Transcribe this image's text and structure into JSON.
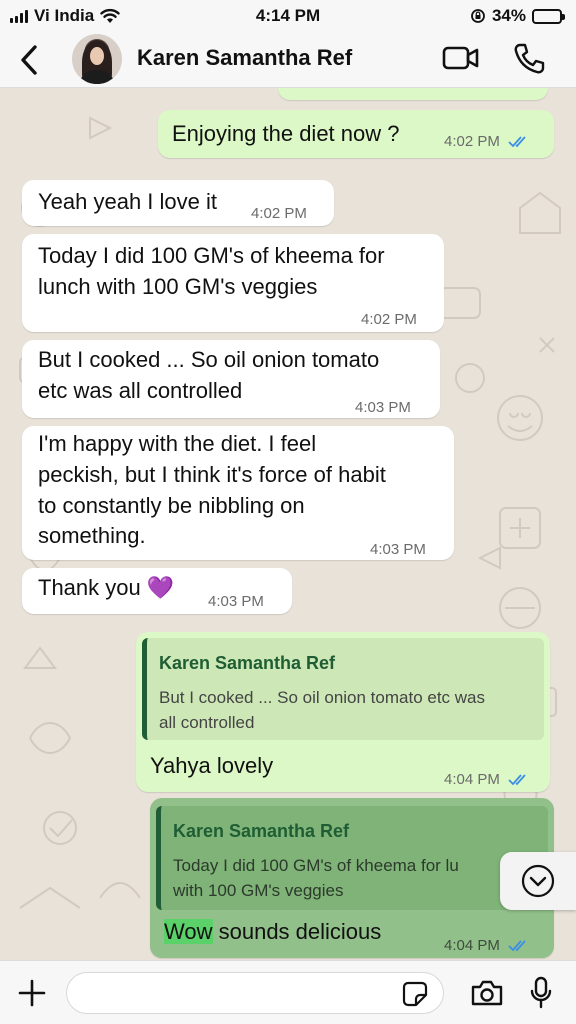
{
  "status_bar": {
    "carrier": "Vi India",
    "time": "4:14 PM",
    "battery_percent": "34%",
    "battery_level": 0.34,
    "icons": [
      "signal-bars-icon",
      "wifi-icon",
      "orientation-lock-icon",
      "battery-icon"
    ]
  },
  "header": {
    "contact_name": "Karen Samantha Ref",
    "icons": [
      "back-chevron-icon",
      "avatar",
      "video-camera-icon",
      "phone-icon"
    ]
  },
  "messages": [
    {
      "direction": "out",
      "text": "Enjoying the diet now ?",
      "time": "4:02 PM",
      "read": true
    },
    {
      "direction": "in",
      "text": "Yeah yeah I love it",
      "time": "4:02 PM"
    },
    {
      "direction": "in",
      "lines": [
        "Today I did 100 GM's of kheema for",
        "lunch with 100 GM's veggies"
      ],
      "time": "4:02 PM"
    },
    {
      "direction": "in",
      "lines": [
        "But I cooked ... So oil onion tomato",
        "etc was all controlled"
      ],
      "time": "4:03 PM"
    },
    {
      "direction": "in",
      "lines": [
        "I'm happy with the diet. I feel",
        "peckish, but I think it's force of habit",
        "to constantly be nibbling on",
        "something."
      ],
      "time": "4:03 PM"
    },
    {
      "direction": "in",
      "text": "Thank you 💜",
      "time": "4:03 PM"
    },
    {
      "direction": "out",
      "quote_name": "Karen Samantha Ref",
      "quote_lines": [
        "But I cooked ... So oil onion tomato etc was",
        "all controlled"
      ],
      "text": "Yahya lovely",
      "time": "4:04 PM",
      "read": true
    },
    {
      "direction": "out",
      "quote_name": "Karen Samantha Ref",
      "quote_lines": [
        "Today I did 100 GM's of kheema for lu",
        "with 100 GM's veggies"
      ],
      "highlight": "Wow",
      "text": " sounds delicious",
      "time": "4:04 PM",
      "read": true
    }
  ],
  "input_bar": {
    "placeholder": "",
    "icons": [
      "plus-icon",
      "sticker-icon",
      "camera-icon",
      "microphone-icon"
    ]
  },
  "colors": {
    "outgoing_bubble": "#dbf8c6",
    "incoming_bubble": "#ffffff",
    "quote_accent": "#1f5e34",
    "read_ticks": "#3b8ee8",
    "chat_background": "#e8e2d9",
    "highlight": "#5bd16a"
  }
}
